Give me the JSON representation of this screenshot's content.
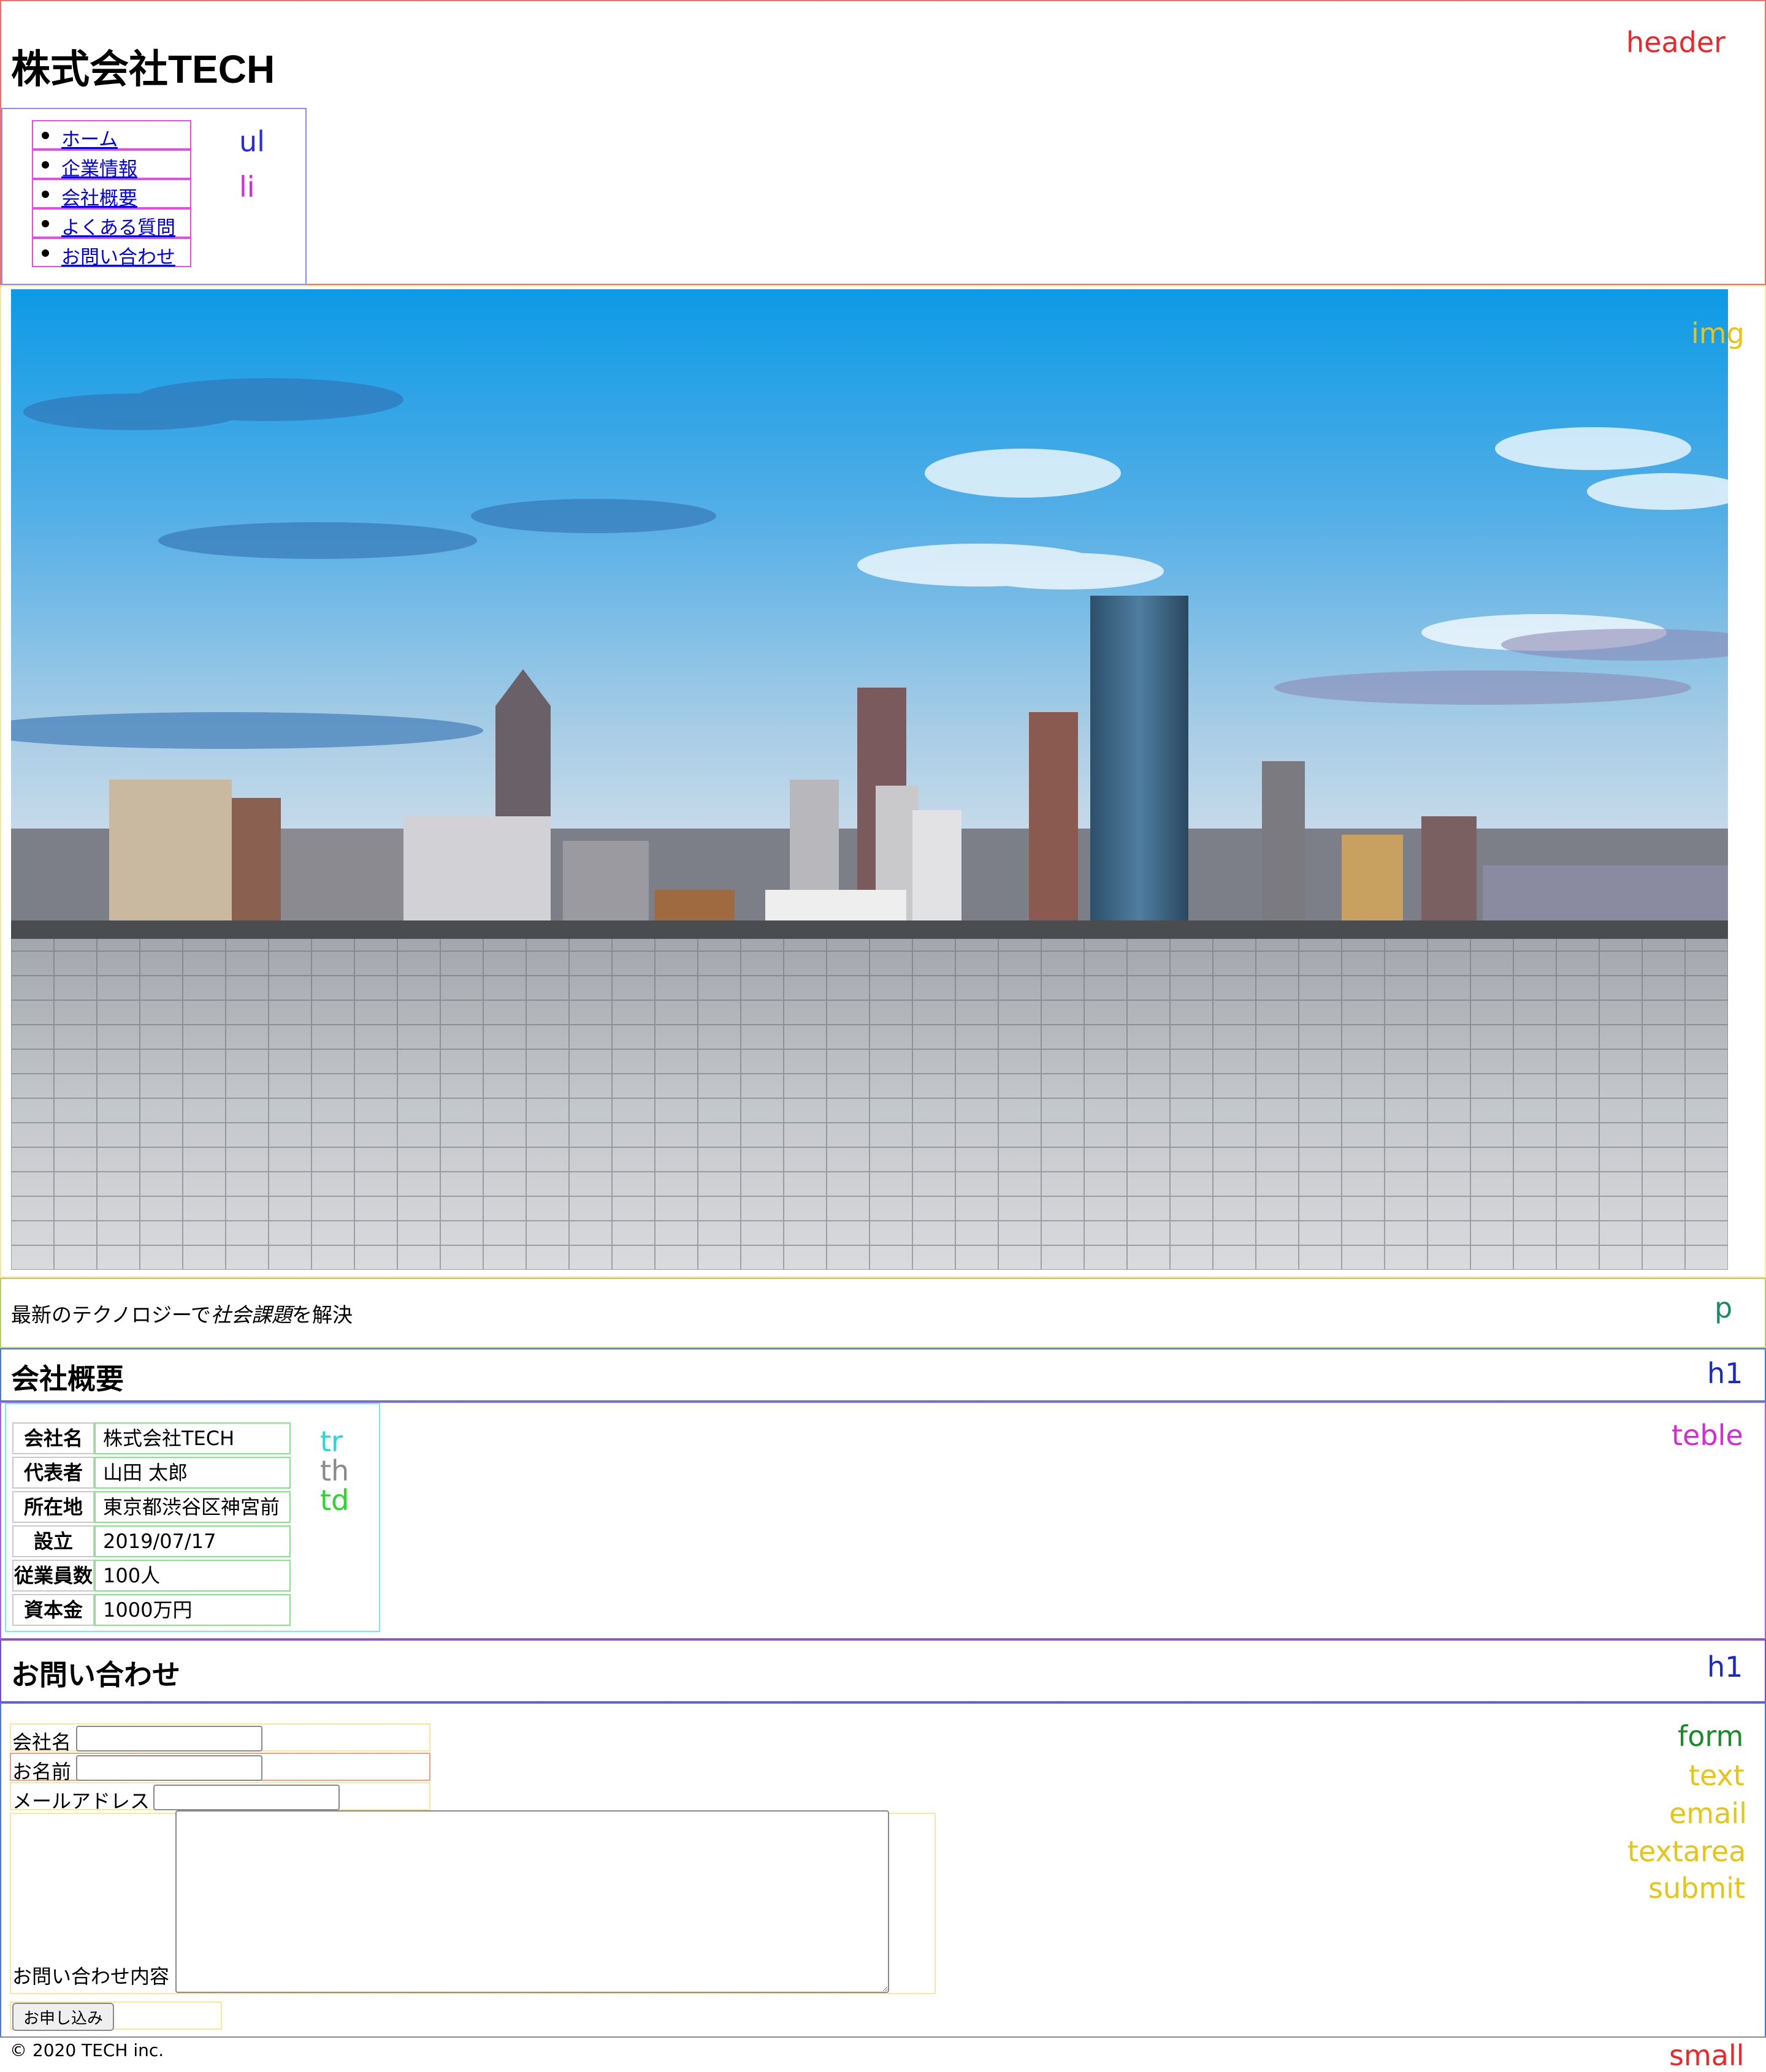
{
  "header": {
    "site_title": "株式会社TECH",
    "nav_items": [
      "ホーム",
      "企業情報",
      "会社概要",
      "よくある質問",
      "お問い合わせ"
    ]
  },
  "tagline": {
    "plain": "最新のテクノロジーで",
    "emphasis": "社会課題",
    "rest": "を解決"
  },
  "company": {
    "heading": "会社概要",
    "rows": [
      {
        "label": "会社名",
        "value": "株式会社TECH"
      },
      {
        "label": "代表者",
        "value": "山田 太郎"
      },
      {
        "label": "所在地",
        "value": "東京都渋谷区神宮前"
      },
      {
        "label": "設立",
        "value": "2019/07/17"
      },
      {
        "label": "従業員数",
        "value": "100人"
      },
      {
        "label": "資本金",
        "value": "1000万円"
      }
    ]
  },
  "contact": {
    "heading": "お問い合わせ",
    "fields": {
      "company_label": "会社名",
      "name_label": "お名前",
      "email_label": "メールアドレス",
      "message_label": "お問い合わせ内容",
      "company_value": "",
      "name_value": "",
      "email_value": "",
      "message_value": ""
    },
    "submit_label": "お申し込み"
  },
  "footer": {
    "copyright": "© 2020 TECH inc."
  },
  "annotations": {
    "header": "header",
    "ul": "ul",
    "li": "li",
    "img": "img",
    "p": "p",
    "h1_company": "h1",
    "table": "teble",
    "tr": "tr",
    "th": "th",
    "td": "td",
    "h1_contact": "h1",
    "form": "form",
    "text": "text",
    "email": "email",
    "textarea": "textarea",
    "submit": "submit",
    "small": "small"
  },
  "annotation_colors": {
    "header": "#e8282a",
    "ul": "#2a2ae0",
    "li": "#d72ad7",
    "img": "#e6c41a",
    "p": "#1a8a6a",
    "h1": "#1a2ac0",
    "table": "#d72ad7",
    "tr": "#2ad7d7",
    "th": "#8a8a8a",
    "td": "#2ad72a",
    "form": "#1a8a2a",
    "field": "#e6c41a",
    "small": "#e8282a"
  }
}
